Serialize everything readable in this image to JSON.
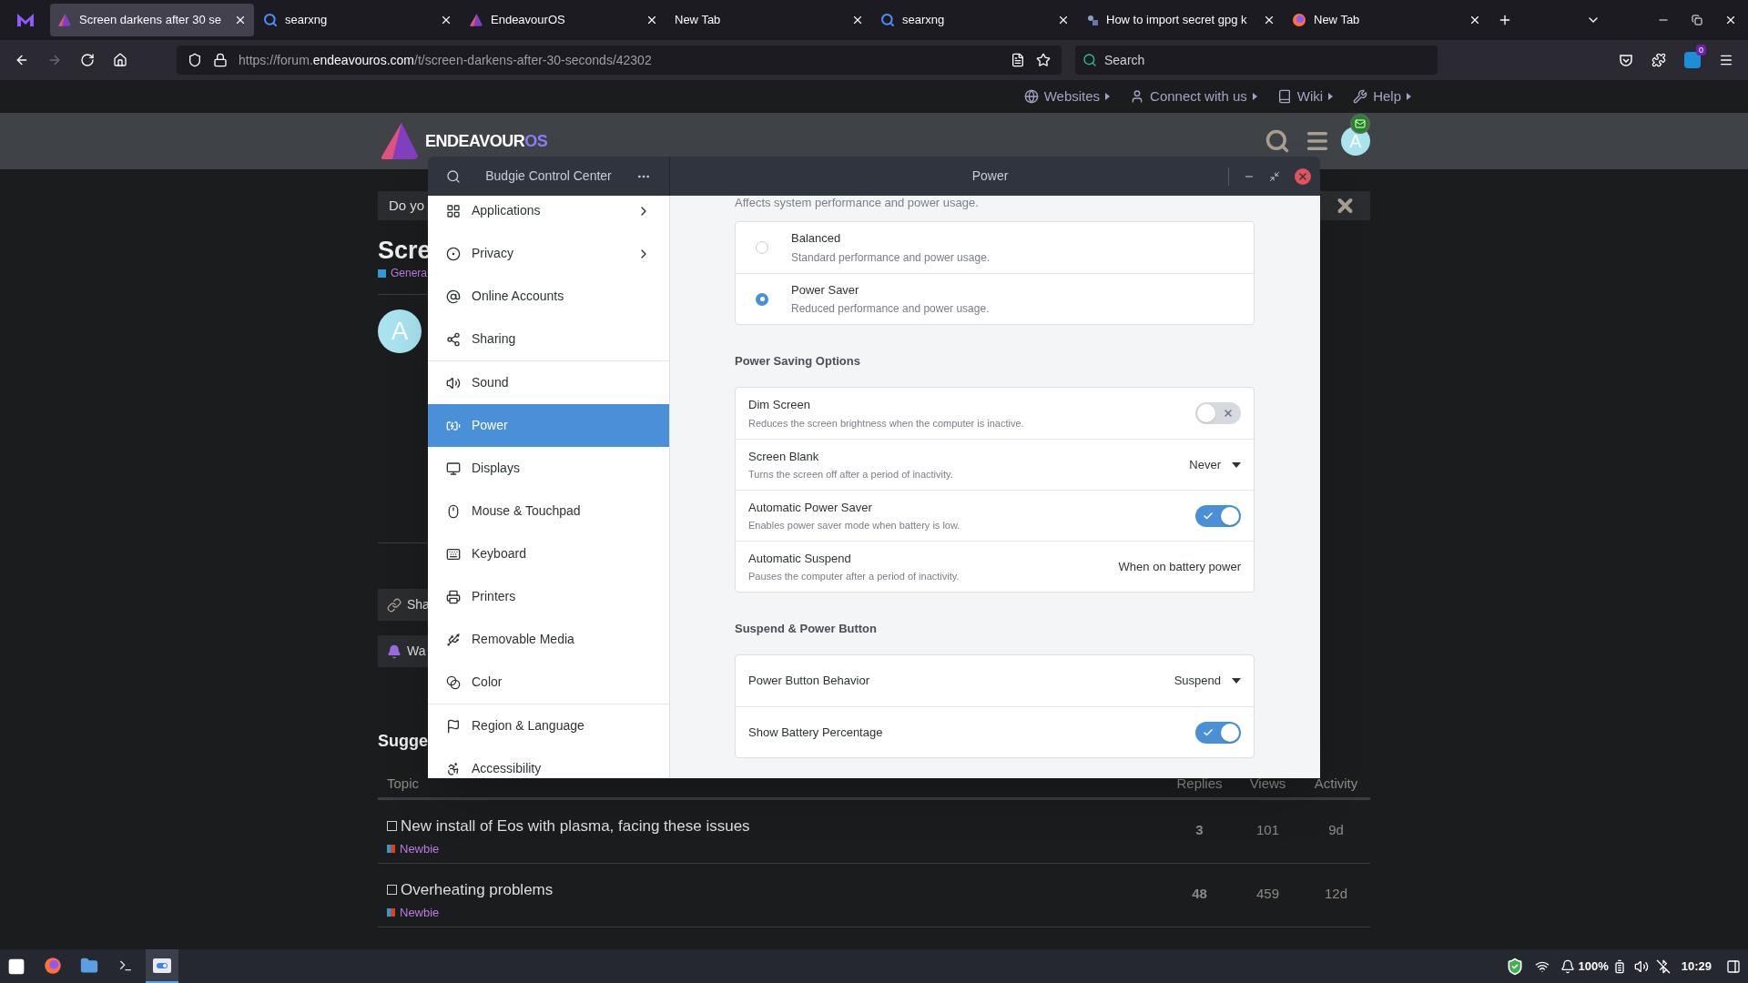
{
  "browser": {
    "tabs": [
      {
        "title": "Screen darkens after 30 se",
        "kind": "endeavour",
        "selected": true
      },
      {
        "title": "searxng",
        "kind": "search",
        "selected": false
      },
      {
        "title": "EndeavourOS",
        "kind": "endeavour",
        "selected": false
      },
      {
        "title": "New Tab",
        "kind": "blank",
        "selected": false
      },
      {
        "title": "searxng",
        "kind": "search",
        "selected": false
      },
      {
        "title": "How to import secret gpg k",
        "kind": "site",
        "selected": false
      },
      {
        "title": "New Tab",
        "kind": "firefox",
        "selected": false
      }
    ],
    "url": {
      "prefix": "https://forum.",
      "domain": "endeavouros.com",
      "path": "/t/screen-darkens-after-30-seconds/42302"
    },
    "search": {
      "placeholder": "Search"
    },
    "extension_badge": "0"
  },
  "forum": {
    "nav_links": [
      "Websites",
      "Connect with us",
      "Wiki",
      "Help"
    ],
    "logo": {
      "main": "ENDEAVOUR",
      "suffix": "OS"
    },
    "user_avatar": "A",
    "banner": "Do yo",
    "topic_title": "Scre",
    "category": "Genera",
    "post_avatar": "A",
    "actions": [
      "Sha",
      "Wa"
    ],
    "suggested_heading": "Sugge",
    "table": {
      "columns": [
        "Topic",
        "Replies",
        "Views",
        "Activity"
      ],
      "rows": [
        {
          "title": "New install of Eos with plasma, facing these issues",
          "category": "Newbie",
          "replies": "3",
          "views": "101",
          "activity": "9d"
        },
        {
          "title": "Overheating problems",
          "category": "Newbie",
          "replies": "48",
          "views": "459",
          "activity": "12d"
        }
      ]
    }
  },
  "dialog": {
    "app_title": "Budgie Control Center",
    "page_title": "Power",
    "sidebar": {
      "groups": [
        [
          {
            "label": "Applications",
            "submenu": true,
            "selected": false
          },
          {
            "label": "Privacy",
            "submenu": true,
            "selected": false
          },
          {
            "label": "Online Accounts",
            "submenu": false,
            "selected": false
          },
          {
            "label": "Sharing",
            "submenu": false,
            "selected": false
          }
        ],
        [
          {
            "label": "Sound",
            "submenu": false,
            "selected": false
          },
          {
            "label": "Power",
            "submenu": false,
            "selected": true
          },
          {
            "label": "Displays",
            "submenu": false,
            "selected": false
          },
          {
            "label": "Mouse & Touchpad",
            "submenu": false,
            "selected": false
          },
          {
            "label": "Keyboard",
            "submenu": false,
            "selected": false
          },
          {
            "label": "Printers",
            "submenu": false,
            "selected": false
          },
          {
            "label": "Removable Media",
            "submenu": false,
            "selected": false
          },
          {
            "label": "Color",
            "submenu": false,
            "selected": false
          }
        ],
        [
          {
            "label": "Region & Language",
            "submenu": false,
            "selected": false
          },
          {
            "label": "Accessibility",
            "submenu": false,
            "selected": false
          }
        ]
      ]
    },
    "intro": "Affects system performance and power usage.",
    "modes": [
      {
        "title": "Balanced",
        "description": "Standard performance and power usage.",
        "selected": false
      },
      {
        "title": "Power Saver",
        "description": "Reduced performance and power usage.",
        "selected": true
      }
    ],
    "sections": [
      {
        "heading": "Power Saving Options",
        "rows": [
          {
            "kind": "toggle",
            "title": "Dim Screen",
            "description": "Reduces the screen brightness when the computer is inactive.",
            "on": false
          },
          {
            "kind": "dropdown",
            "title": "Screen Blank",
            "description": "Turns the screen off after a period of inactivity.",
            "value": "Never"
          },
          {
            "kind": "toggle",
            "title": "Automatic Power Saver",
            "description": "Enables power saver mode when battery is low.",
            "on": true
          },
          {
            "kind": "value",
            "title": "Automatic Suspend",
            "description": "Pauses the computer after a period of inactivity.",
            "value": "When on battery power"
          }
        ]
      },
      {
        "heading": "Suspend & Power Button",
        "rows": [
          {
            "kind": "dropdown",
            "title": "Power Button Behavior",
            "value": "Suspend"
          },
          {
            "kind": "toggle",
            "title": "Show Battery Percentage",
            "on": true
          }
        ]
      }
    ]
  },
  "taskbar": {
    "apps": [
      {
        "kind": "firefox",
        "selected": false
      },
      {
        "kind": "files",
        "selected": false
      },
      {
        "kind": "terminal",
        "selected": false
      },
      {
        "kind": "settings",
        "selected": true
      }
    ],
    "battery": "100%",
    "clock": "10:29"
  }
}
